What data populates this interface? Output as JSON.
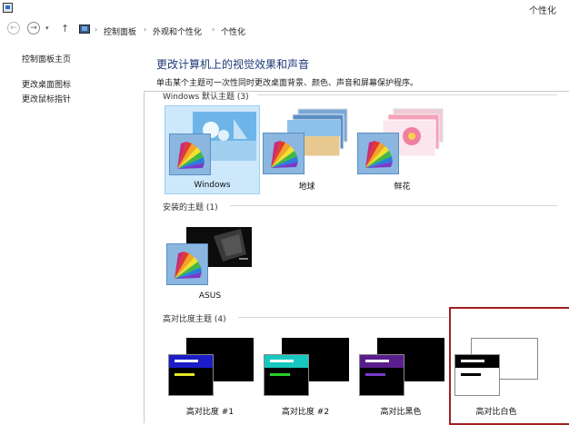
{
  "window": {
    "title": "个性化"
  },
  "nav": {
    "back_glyph": "←",
    "forward_glyph": "→",
    "dropdown_glyph": "▾",
    "up_glyph": "↑",
    "sep_glyph": "›",
    "breadcrumbs": [
      "控制面板",
      "外观和个性化",
      "个性化"
    ]
  },
  "sidebar": {
    "items": [
      "控制面板主页",
      "更改桌面图标",
      "更改鼠标指针"
    ]
  },
  "main": {
    "title": "更改计算机上的视觉效果和声音",
    "subtitle": "单击某个主题可一次性同时更改桌面背景、颜色、声音和屏幕保护程序。"
  },
  "groups": {
    "windows": {
      "header": "Windows 默认主题 (3)",
      "themes": [
        "Windows",
        "地球",
        "鲜花"
      ]
    },
    "installed": {
      "header": "安装的主题 (1)",
      "themes": [
        "ASUS"
      ]
    },
    "high_contrast": {
      "header": "高对比度主题 (4)",
      "themes": [
        "高对比度 #1",
        "高对比度 #2",
        "高对比黑色",
        "高对比白色"
      ]
    }
  },
  "colors": {
    "accent": "#1e3a78",
    "selection": "#cde8fb",
    "highlight_border": "#a02020"
  }
}
